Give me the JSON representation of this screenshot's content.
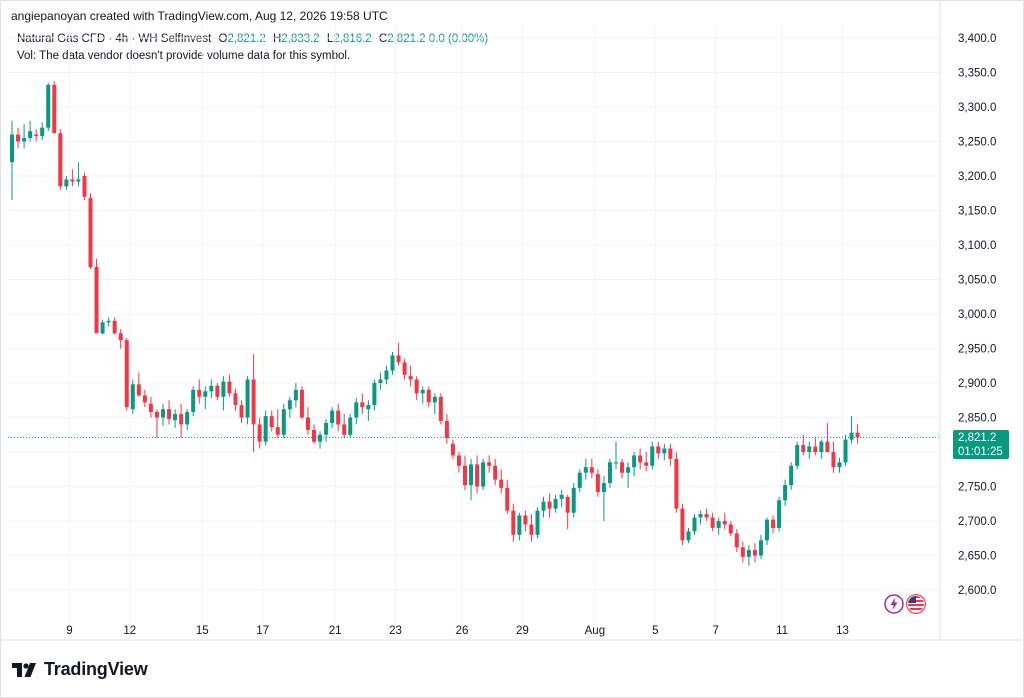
{
  "attribution": "angiepanoyan created with TradingView.com, Aug 12, 2026 19:58 UTC",
  "legend": {
    "symbol": "Natural Gas CFD · 4h · WH SelfInvest",
    "o_label": "O",
    "o_value": "2,821.2",
    "h_label": "H",
    "h_value": "2,833.2",
    "l_label": "L",
    "l_value": "2,816.2",
    "c_label": "C",
    "c_value": "2,821.2",
    "change": "0.0 (0.00%)",
    "vol_note": "Vol: The data vendor doesn't provide volume data for this symbol."
  },
  "price_tag": {
    "price": "2,821.2",
    "countdown": "01:01:25"
  },
  "brand": {
    "name": "TradingView"
  },
  "colors": {
    "up": "#089981",
    "down": "#f23645",
    "grid": "#f0f3fa",
    "text": "#131722"
  },
  "icons": [
    "tradingview-logo-icon",
    "lightning-badge-icon",
    "us-flag-badge-icon"
  ],
  "chart_data": {
    "type": "candlestick",
    "timeframe": "4h",
    "ylim": [
      2570,
      3420
    ],
    "y_ticks": [
      "3,400.0",
      "3,350.0",
      "3,300.0",
      "3,250.0",
      "3,200.0",
      "3,150.0",
      "3,100.0",
      "3,050.0",
      "3,000.0",
      "2,950.0",
      "2,900.0",
      "2,850.0",
      "2,800.0",
      "2,750.0",
      "2,700.0",
      "2,650.0",
      "2,600.0"
    ],
    "y_tick_values": [
      3400,
      3350,
      3300,
      3250,
      3200,
      3150,
      3100,
      3050,
      3000,
      2950,
      2900,
      2850,
      2800,
      2750,
      2700,
      2650,
      2600
    ],
    "x_ticks": [
      "9",
      "12",
      "15",
      "17",
      "21",
      "23",
      "26",
      "29",
      "Aug",
      "5",
      "7",
      "11",
      "13"
    ],
    "x_tick_index": [
      10,
      20,
      32,
      42,
      54,
      64,
      75,
      85,
      97,
      107,
      117,
      128,
      138
    ],
    "last_price": 2821.2,
    "candles": [
      [
        3220,
        3280,
        3165,
        3260
      ],
      [
        3260,
        3270,
        3240,
        3250
      ],
      [
        3250,
        3275,
        3240,
        3255
      ],
      [
        3255,
        3280,
        3250,
        3265
      ],
      [
        3260,
        3268,
        3250,
        3258
      ],
      [
        3258,
        3278,
        3252,
        3270
      ],
      [
        3270,
        3335,
        3265,
        3332
      ],
      [
        3332,
        3338,
        3262,
        3262
      ],
      [
        3262,
        3268,
        3180,
        3185
      ],
      [
        3185,
        3200,
        3180,
        3195
      ],
      [
        3195,
        3210,
        3185,
        3192
      ],
      [
        3192,
        3220,
        3185,
        3195
      ],
      [
        3200,
        3205,
        3165,
        3170
      ],
      [
        3168,
        3175,
        3065,
        3068
      ],
      [
        3068,
        3080,
        2980,
        2972
      ],
      [
        2972,
        2992,
        2970,
        2988
      ],
      [
        2988,
        2995,
        2982,
        2990
      ],
      [
        2990,
        2995,
        2970,
        2972
      ],
      [
        2972,
        2978,
        2950,
        2962
      ],
      [
        2962,
        2965,
        2860,
        2865
      ],
      [
        2862,
        2905,
        2855,
        2898
      ],
      [
        2898,
        2915,
        2880,
        2882
      ],
      [
        2882,
        2890,
        2865,
        2872
      ],
      [
        2870,
        2880,
        2850,
        2858
      ],
      [
        2858,
        2862,
        2820,
        2850
      ],
      [
        2850,
        2870,
        2838,
        2862
      ],
      [
        2862,
        2875,
        2840,
        2848
      ],
      [
        2846,
        2862,
        2835,
        2855
      ],
      [
        2855,
        2870,
        2820,
        2840
      ],
      [
        2840,
        2862,
        2832,
        2858
      ],
      [
        2858,
        2895,
        2852,
        2890
      ],
      [
        2890,
        2905,
        2870,
        2880
      ],
      [
        2880,
        2895,
        2862,
        2888
      ],
      [
        2888,
        2905,
        2878,
        2896
      ],
      [
        2896,
        2900,
        2875,
        2880
      ],
      [
        2880,
        2910,
        2860,
        2902
      ],
      [
        2902,
        2912,
        2880,
        2885
      ],
      [
        2885,
        2892,
        2860,
        2868
      ],
      [
        2868,
        2875,
        2842,
        2850
      ],
      [
        2850,
        2910,
        2840,
        2905
      ],
      [
        2905,
        2942,
        2800,
        2840
      ],
      [
        2840,
        2850,
        2805,
        2815
      ],
      [
        2815,
        2860,
        2810,
        2852
      ],
      [
        2852,
        2860,
        2830,
        2836
      ],
      [
        2836,
        2862,
        2820,
        2825
      ],
      [
        2825,
        2870,
        2820,
        2862
      ],
      [
        2862,
        2880,
        2850,
        2875
      ],
      [
        2875,
        2900,
        2865,
        2890
      ],
      [
        2890,
        2895,
        2848,
        2850
      ],
      [
        2850,
        2865,
        2825,
        2832
      ],
      [
        2832,
        2840,
        2812,
        2815
      ],
      [
        2815,
        2830,
        2805,
        2825
      ],
      [
        2825,
        2848,
        2815,
        2842
      ],
      [
        2842,
        2865,
        2835,
        2860
      ],
      [
        2860,
        2870,
        2830,
        2840
      ],
      [
        2840,
        2855,
        2820,
        2825
      ],
      [
        2825,
        2855,
        2820,
        2850
      ],
      [
        2850,
        2878,
        2840,
        2872
      ],
      [
        2872,
        2885,
        2855,
        2865
      ],
      [
        2862,
        2875,
        2845,
        2868
      ],
      [
        2868,
        2905,
        2860,
        2900
      ],
      [
        2900,
        2915,
        2890,
        2905
      ],
      [
        2905,
        2925,
        2898,
        2918
      ],
      [
        2918,
        2945,
        2912,
        2940
      ],
      [
        2940,
        2958,
        2925,
        2930
      ],
      [
        2930,
        2935,
        2905,
        2912
      ],
      [
        2910,
        2925,
        2895,
        2905
      ],
      [
        2905,
        2910,
        2875,
        2885
      ],
      [
        2885,
        2895,
        2870,
        2890
      ],
      [
        2890,
        2895,
        2865,
        2872
      ],
      [
        2872,
        2885,
        2855,
        2880
      ],
      [
        2880,
        2885,
        2840,
        2845
      ],
      [
        2845,
        2855,
        2812,
        2820
      ],
      [
        2812,
        2818,
        2790,
        2795
      ],
      [
        2795,
        2800,
        2770,
        2780
      ],
      [
        2780,
        2795,
        2745,
        2752
      ],
      [
        2752,
        2790,
        2730,
        2782
      ],
      [
        2782,
        2795,
        2740,
        2750
      ],
      [
        2750,
        2790,
        2745,
        2785
      ],
      [
        2785,
        2795,
        2770,
        2780
      ],
      [
        2780,
        2790,
        2752,
        2760
      ],
      [
        2760,
        2775,
        2740,
        2748
      ],
      [
        2748,
        2760,
        2710,
        2715
      ],
      [
        2715,
        2725,
        2670,
        2680
      ],
      [
        2680,
        2712,
        2672,
        2708
      ],
      [
        2708,
        2715,
        2685,
        2695
      ],
      [
        2695,
        2710,
        2670,
        2680
      ],
      [
        2680,
        2720,
        2675,
        2715
      ],
      [
        2715,
        2735,
        2705,
        2728
      ],
      [
        2728,
        2740,
        2705,
        2718
      ],
      [
        2718,
        2738,
        2712,
        2732
      ],
      [
        2732,
        2745,
        2720,
        2738
      ],
      [
        2735,
        2738,
        2688,
        2712
      ],
      [
        2712,
        2755,
        2705,
        2748
      ],
      [
        2748,
        2775,
        2742,
        2770
      ],
      [
        2770,
        2790,
        2760,
        2778
      ],
      [
        2778,
        2790,
        2762,
        2770
      ],
      [
        2768,
        2775,
        2735,
        2742
      ],
      [
        2742,
        2765,
        2700,
        2755
      ],
      [
        2755,
        2790,
        2748,
        2785
      ],
      [
        2785,
        2815,
        2775,
        2785
      ],
      [
        2785,
        2790,
        2762,
        2770
      ],
      [
        2770,
        2785,
        2748,
        2778
      ],
      [
        2778,
        2800,
        2765,
        2795
      ],
      [
        2795,
        2805,
        2775,
        2785
      ],
      [
        2785,
        2800,
        2772,
        2780
      ],
      [
        2780,
        2815,
        2775,
        2808
      ],
      [
        2808,
        2815,
        2790,
        2798
      ],
      [
        2798,
        2812,
        2788,
        2805
      ],
      [
        2805,
        2812,
        2780,
        2790
      ],
      [
        2790,
        2800,
        2712,
        2718
      ],
      [
        2718,
        2725,
        2665,
        2672
      ],
      [
        2672,
        2690,
        2668,
        2685
      ],
      [
        2685,
        2710,
        2680,
        2705
      ],
      [
        2705,
        2715,
        2695,
        2710
      ],
      [
        2710,
        2718,
        2700,
        2705
      ],
      [
        2705,
        2712,
        2685,
        2690
      ],
      [
        2690,
        2705,
        2680,
        2700
      ],
      [
        2700,
        2712,
        2688,
        2695
      ],
      [
        2695,
        2700,
        2678,
        2682
      ],
      [
        2682,
        2688,
        2655,
        2662
      ],
      [
        2662,
        2670,
        2640,
        2648
      ],
      [
        2648,
        2665,
        2635,
        2658
      ],
      [
        2658,
        2668,
        2640,
        2650
      ],
      [
        2650,
        2680,
        2645,
        2672
      ],
      [
        2672,
        2705,
        2665,
        2702
      ],
      [
        2702,
        2708,
        2682,
        2690
      ],
      [
        2690,
        2735,
        2685,
        2730
      ],
      [
        2730,
        2760,
        2722,
        2752
      ],
      [
        2752,
        2785,
        2745,
        2780
      ],
      [
        2780,
        2815,
        2775,
        2810
      ],
      [
        2810,
        2825,
        2795,
        2800
      ],
      [
        2800,
        2815,
        2790,
        2808
      ],
      [
        2808,
        2822,
        2795,
        2800
      ],
      [
        2800,
        2818,
        2790,
        2815
      ],
      [
        2815,
        2842,
        2805,
        2800
      ],
      [
        2800,
        2815,
        2770,
        2778
      ],
      [
        2778,
        2792,
        2770,
        2785
      ],
      [
        2785,
        2825,
        2780,
        2818
      ],
      [
        2818,
        2852,
        2812,
        2828
      ],
      [
        2828,
        2840,
        2812,
        2821
      ]
    ]
  }
}
